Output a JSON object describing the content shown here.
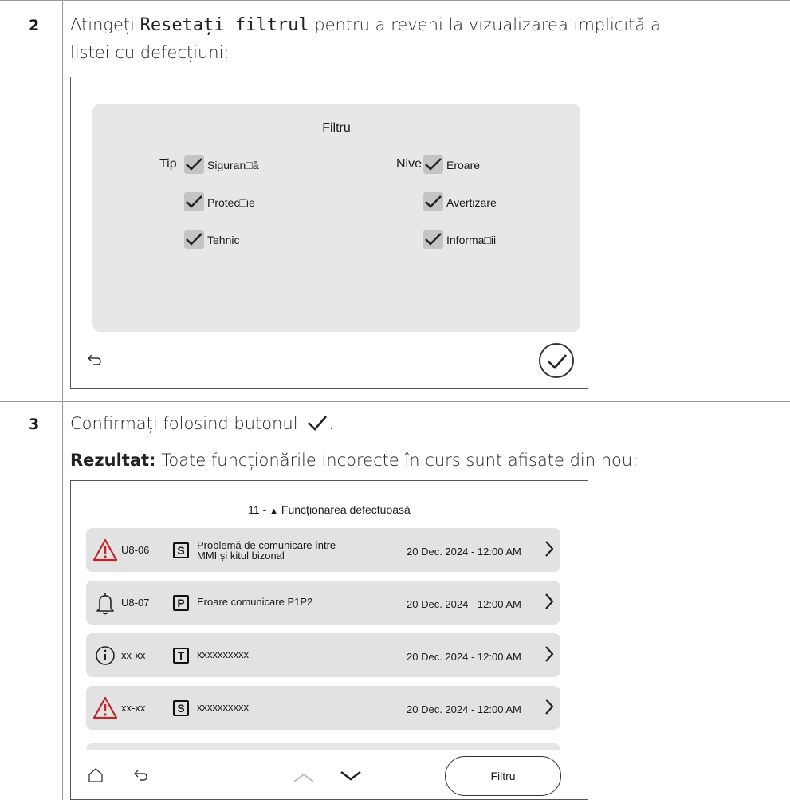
{
  "steps": [
    {
      "number": "2",
      "text_before": "Atingeți ",
      "code": "Resetați filtrul",
      "text_after": " pentru a reveni la vizualizarea implicită a",
      "text_line2": "listei cu defecțiuni:"
    },
    {
      "number": "3",
      "text": "Confirmați folosind butonul",
      "text_end": ".",
      "result_label": "Rezultat:",
      "result_text": " Toate funcționările incorecte în curs sunt afișate din nou:"
    }
  ],
  "filter_screen": {
    "title": "Filtru",
    "type_label": "Tip",
    "level_label": "Nivel",
    "type_options": [
      {
        "label": "Siguran□ă",
        "checked": true
      },
      {
        "label": "Protec□ie",
        "checked": true
      },
      {
        "label": "Tehnic",
        "checked": true
      }
    ],
    "level_options": [
      {
        "label": "Eroare",
        "checked": true
      },
      {
        "label": "Avertizare",
        "checked": true
      },
      {
        "label": "Informa□ii",
        "checked": true
      }
    ],
    "back_icon": "back-arrow-icon",
    "confirm_icon": "checkmark-circle-icon"
  },
  "fault_screen": {
    "title_prefix": "11 - ",
    "title_icon": "▲",
    "title_text": " Funcționarea defectuoasă",
    "rows": [
      {
        "icon": "warning-triangle-icon",
        "code": "U8-06",
        "badge": "S",
        "desc_line1": "Problemă de comunicare între",
        "desc_line2": "MMI și kitul bizonal",
        "date": "20 Dec. 2024 - 12:00 AM"
      },
      {
        "icon": "bell-icon",
        "code": "U8-07",
        "badge": "P",
        "desc_line1": "Eroare comunicare P1P2",
        "desc_line2": "",
        "date": "20 Dec. 2024 - 12:00 AM"
      },
      {
        "icon": "info-circle-icon",
        "code": "xx-xx",
        "badge": "T",
        "desc_line1": "xxxxxxxxxx",
        "desc_line2": "",
        "date": "20 Dec. 2024 - 12:00 AM"
      },
      {
        "icon": "warning-triangle-icon",
        "code": "xx-xx",
        "badge": "S",
        "desc_line1": "xxxxxxxxxx",
        "desc_line2": "",
        "date": "20 Dec. 2024 - 12:00 AM"
      }
    ],
    "filter_button": "Filtru",
    "colors": {
      "warning": "#c0272d",
      "row_bg": "#e2e2e2"
    }
  }
}
